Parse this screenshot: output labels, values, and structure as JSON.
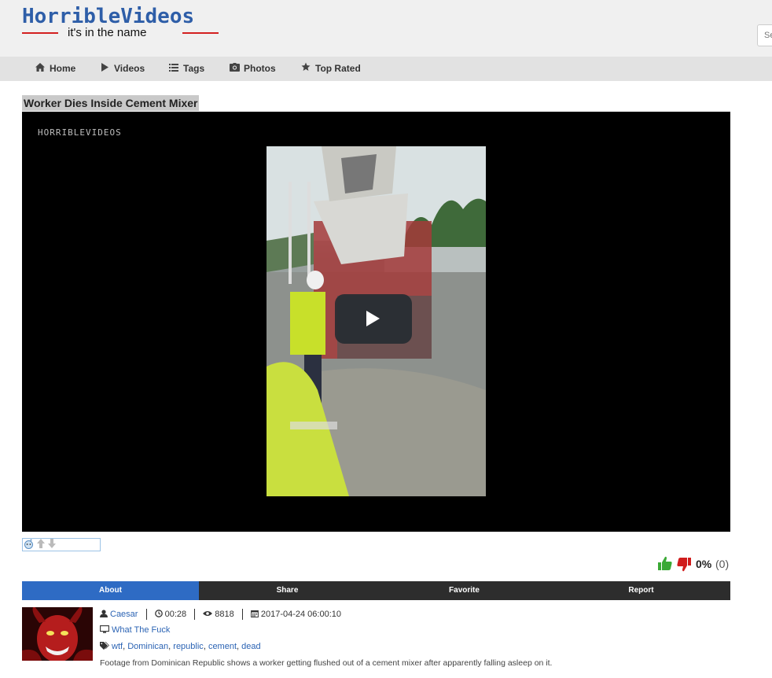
{
  "site": {
    "logo_title": "HorribleVideos",
    "logo_tagline": "it's in the name",
    "search_placeholder": "Se"
  },
  "nav": {
    "items": [
      {
        "label": "Home",
        "icon": "home-icon"
      },
      {
        "label": "Videos",
        "icon": "play-icon"
      },
      {
        "label": "Tags",
        "icon": "list-icon"
      },
      {
        "label": "Photos",
        "icon": "camera-icon"
      },
      {
        "label": "Top Rated",
        "icon": "star-icon"
      }
    ]
  },
  "video": {
    "title": "Worker Dies Inside Cement Mixer",
    "watermark": "HORRIBLEVIDEOS"
  },
  "rating": {
    "percent": "0%",
    "count": "(0)",
    "like_color": "#3aa935",
    "dislike_color": "#d01c1c"
  },
  "tabs": [
    {
      "label": "About",
      "active": true
    },
    {
      "label": "Share",
      "active": false
    },
    {
      "label": "Favorite",
      "active": false
    },
    {
      "label": "Report",
      "active": false
    }
  ],
  "details": {
    "author": "Caesar",
    "duration": "00:28",
    "views": "8818",
    "date": "2017-04-24 06:00:10",
    "category": "What The Fuck",
    "tags": [
      "wtf",
      "Dominican",
      "republic",
      "cement",
      "dead"
    ],
    "description": "Footage from Dominican Republic shows a worker getting flushed out of a cement mixer after apparently falling asleep on it."
  },
  "colors": {
    "accent": "#2e6bc4",
    "link": "#2c64b4",
    "logo_blue": "#2e5ea8",
    "logo_red": "#d32020"
  }
}
